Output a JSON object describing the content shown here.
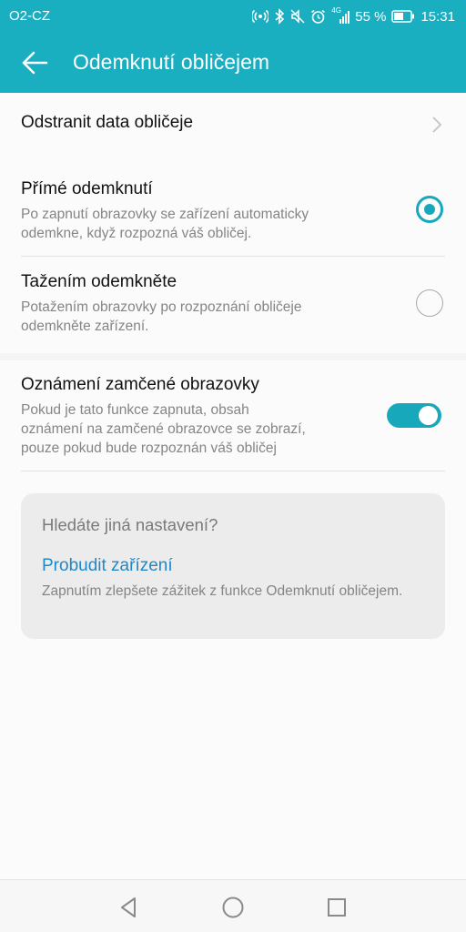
{
  "status_bar": {
    "carrier": "O2-CZ",
    "network": "4G",
    "battery": "55 %",
    "time": "15:31",
    "icons": [
      "hotspot-icon",
      "bluetooth-icon",
      "mute-icon",
      "alarm-icon",
      "signal-icon",
      "battery-icon"
    ]
  },
  "header": {
    "title": "Odemknutí obličejem",
    "back_icon": "arrow-left-icon"
  },
  "items": {
    "delete_data": {
      "title": "Odstranit data obličeje"
    },
    "direct_unlock": {
      "title": "Přímé odemknutí",
      "sub1": "Po zapnutí obrazovky se zařízení automaticky",
      "sub2": "odemkne, když rozpozná váš obličej.",
      "selected": true
    },
    "swipe_unlock": {
      "title": "Tažením odemkněte",
      "sub1": "Potažením obrazovky po rozpoznání obličeje",
      "sub2": "odemkněte zařízení.",
      "selected": false
    },
    "lock_notifications": {
      "title": "Oznámení zamčené obrazovky",
      "sub1": "Pokud je tato funkce zapnuta, obsah",
      "sub2": "oznámení na zamčené obrazovce se zobrazí,",
      "sub3": "pouze pokud bude rozpoznán váš obličej",
      "enabled": true
    }
  },
  "suggestion": {
    "question": "Hledáte jiná nastavení?",
    "link": "Probudit zařízení",
    "desc": "Zapnutím zlepšete zážitek z funkce Odemknutí obličejem."
  },
  "colors": {
    "accent": "#19aec0",
    "link": "#1e88c8"
  },
  "nav": [
    "back-triangle-icon",
    "home-circle-icon",
    "recents-square-icon"
  ]
}
